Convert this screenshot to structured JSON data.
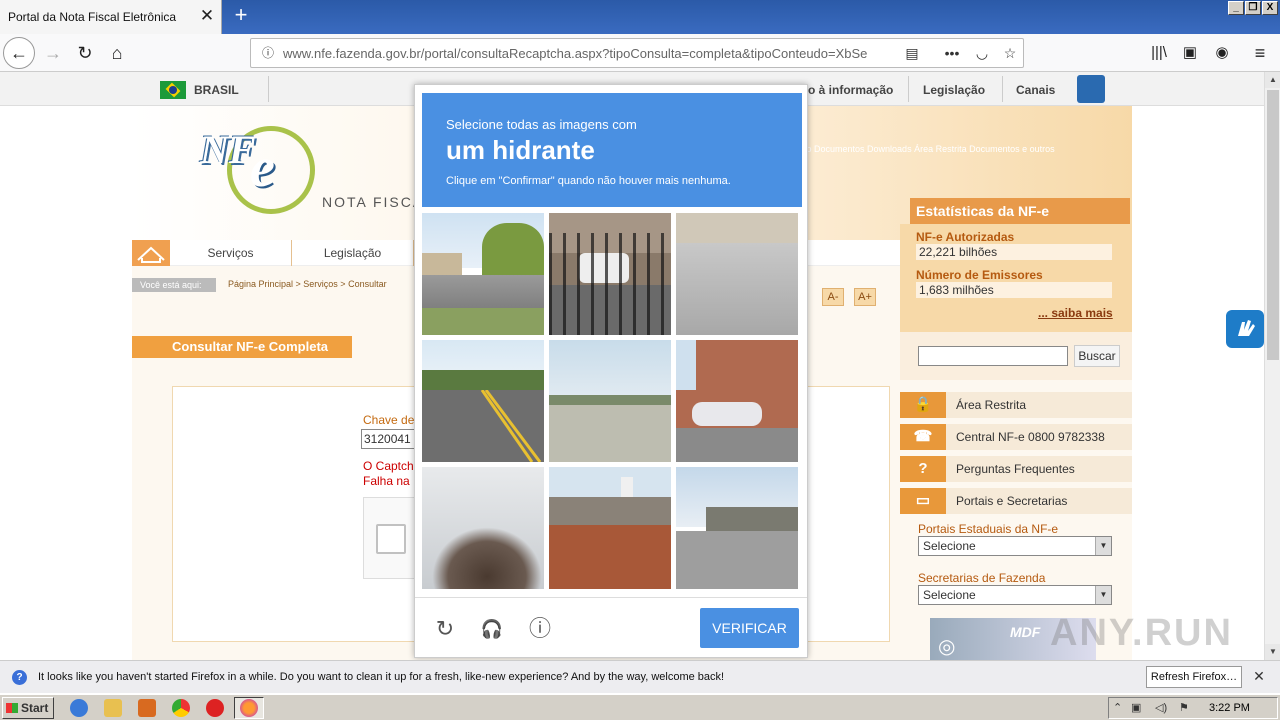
{
  "browser": {
    "tab_title": "Portal da Nota Fiscal Eletrônica",
    "tab_close": "✕",
    "new_tab": "+",
    "url": "www.nfe.fazenda.gov.br/portal/consultaRecaptcha.aspx?tipoConsulta=completa&tipoConteudo=XbSe",
    "win_buttons": [
      "_",
      "❐",
      "X"
    ]
  },
  "gov_bar": {
    "country": "BRASIL",
    "items": [
      "o à informação",
      "Legislação",
      "Canais"
    ]
  },
  "site": {
    "logo": "NF",
    "logo_e": "e",
    "subtitle": "NOTA FISCA",
    "top_links": "ação  Documentos  Downloads  Área Restrita  Documentos e outros",
    "menu": [
      "Serviços",
      "Legislação"
    ],
    "you_are_here": "Você está aqui:",
    "breadcrumb": "Página Principal > Serviços > Consultar",
    "font_smaller": "A-",
    "font_larger": "A+",
    "page_title": "Consultar NF-e Completa",
    "chave_label": "Chave de",
    "chave_value": "3120041",
    "error_line1": "O Captch",
    "error_line2": "Falha na"
  },
  "sidebar": {
    "stats_title": "Estatísticas da NF-e",
    "authorized_label": "NF-e Autorizadas",
    "authorized_value": "22,221 bilhões",
    "issuers_label": "Número de Emissores",
    "issuers_value": "1,683 milhões",
    "more_link": "... saiba mais",
    "search_button": "Buscar",
    "items": [
      {
        "icon": "lock-icon",
        "glyph": "🔒",
        "label": "Área Restrita"
      },
      {
        "icon": "phone-icon",
        "glyph": "☎",
        "label": "Central NF-e 0800 9782338"
      },
      {
        "icon": "question-icon",
        "glyph": "?",
        "label": "Perguntas Frequentes"
      },
      {
        "icon": "window-icon",
        "glyph": "▭",
        "label": "Portais e Secretarias"
      }
    ],
    "state_portals_label": "Portais Estaduais da NF-e",
    "state_portals_value": "Selecione",
    "secretariats_label": "Secretarias de Fazenda",
    "secretariats_value": "Selecione",
    "mdfe_logo": "MDF"
  },
  "captcha": {
    "line1": "Selecione todas as imagens com",
    "line2": "um hidrante",
    "line3": "Clique em \"Confirmar\" quando não houver mais nenhuma.",
    "tiles": [
      {
        "scene": "street-with-trees"
      },
      {
        "scene": "gate-and-car"
      },
      {
        "scene": "pavement"
      },
      {
        "scene": "road-yellow-lines"
      },
      {
        "scene": "highway"
      },
      {
        "scene": "parking-building"
      },
      {
        "scene": "bare-tree"
      },
      {
        "scene": "brick-house"
      },
      {
        "scene": "intersection"
      }
    ],
    "verify_label": "VERIFICAR",
    "reload_glyph": "↻",
    "audio_glyph": "🎧",
    "info_glyph": "ⓘ"
  },
  "notification": {
    "text": "It looks like you haven't started Firefox in a while. Do you want to clean it up for a fresh, like-new experience? And by the way, welcome back!",
    "button": "Refresh Firefox…",
    "close": "✕"
  },
  "taskbar": {
    "start": "Start",
    "clock": "3:22 PM"
  },
  "watermark": "ANY.RUN"
}
